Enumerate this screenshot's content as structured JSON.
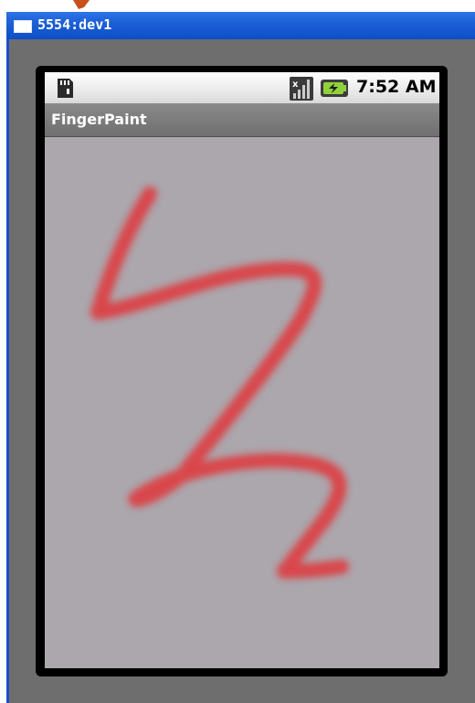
{
  "window": {
    "title": "5554:dev1"
  },
  "statusbar": {
    "time": "7:52 AM",
    "icons": [
      "sd-card-icon",
      "signal-icon",
      "battery-charging-icon"
    ]
  },
  "app": {
    "title": "FingerPaint"
  },
  "canvas": {
    "background_color": "#aba7ad",
    "stroke_color": "#e8262a"
  }
}
